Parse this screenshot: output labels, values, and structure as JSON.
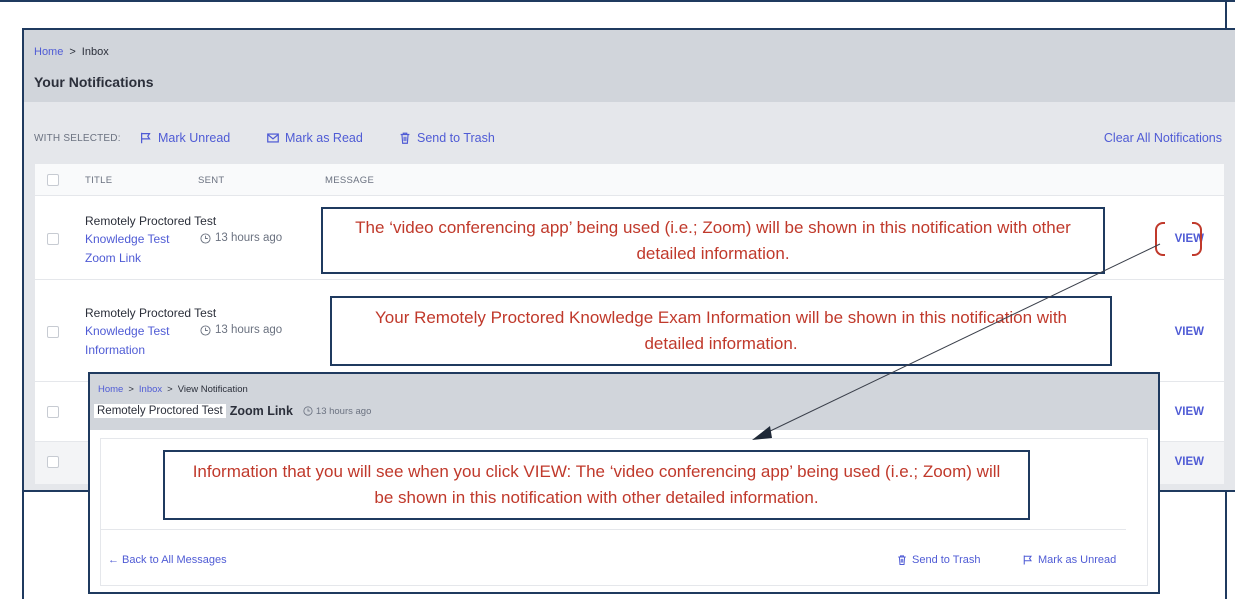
{
  "breadcrumb": {
    "home": "Home",
    "sep": ">",
    "current": "Inbox"
  },
  "page_title": "Your Notifications",
  "toolbar": {
    "with_selected": "WITH SELECTED:",
    "mark_unread": "Mark Unread",
    "mark_read": "Mark as Read",
    "send_trash": "Send to Trash",
    "clear_all": "Clear All Notifications"
  },
  "table": {
    "headers": {
      "title": "TITLE",
      "sent": "SENT",
      "message": "MESSAGE"
    },
    "rows": [
      {
        "title": "Remotely Proctored Test",
        "sub1": "Knowledge Test",
        "sub2": "Zoom Link",
        "time": "13 hours ago",
        "view": "VIEW"
      },
      {
        "title": "Remotely Proctored Test",
        "sub1": "Knowledge Test",
        "sub2": "Information",
        "time": "13 hours ago",
        "view": "VIEW"
      },
      {
        "view": "VIEW"
      },
      {
        "view": "VIEW"
      }
    ]
  },
  "callouts": {
    "first": "The ‘video conferencing app’ being used (i.e.; Zoom) will be shown in this notification with other detailed information.",
    "second": "Your Remotely Proctored Knowledge Exam Information will be shown in this notification with detailed information.",
    "third": "Information that you will see when you click VIEW:  The ‘video conferencing app’ being used (i.e.; Zoom) will be shown in this notification with other detailed information."
  },
  "detail": {
    "breadcrumb": {
      "home": "Home",
      "inbox": "Inbox",
      "current": "View Notification"
    },
    "title_prefix": "Remotely Proctored Test",
    "title_bold": "Zoom Link",
    "time": "13 hours ago",
    "back": "← Back to All Messages",
    "send_trash": "Send to Trash",
    "mark_unread": "Mark as Unread"
  },
  "colors": {
    "accent": "#4f5bd5",
    "annotation_red": "#c0392b",
    "annotation_border": "#1f3a5f"
  }
}
